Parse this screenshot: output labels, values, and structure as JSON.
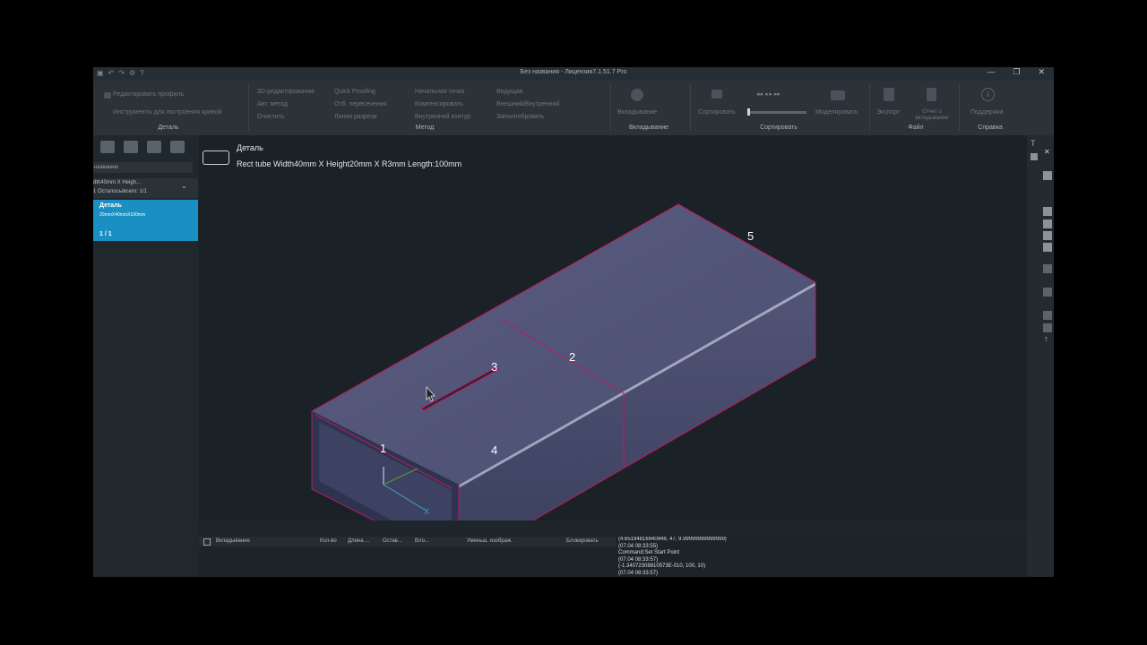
{
  "window": {
    "title": "Без названия - Лицензия7.1.51.7  Pro",
    "min_icon": "—",
    "max_icon": "❐",
    "close_icon": "✕"
  },
  "ribbon": {
    "detail_group": {
      "label": "Деталь",
      "items": [
        "Редактировать профиль",
        "Инструменты для построения кривой"
      ]
    },
    "method_group": {
      "label": "Метод",
      "col1": [
        "3D-редактирование",
        "Авт. метод",
        "Очистить"
      ],
      "col2": [
        "Quick Proofing",
        "Отб. пересечения",
        "Линия разреза"
      ],
      "col3": [
        "Начальная точка",
        "Компенсировать",
        "Внутренний контур"
      ],
      "col4": [
        "Ведущая",
        "Внешний/Внутренний",
        "Заполнобровать"
      ]
    },
    "nesting_group": {
      "label": "Вкладывание",
      "button": "Вкладывание"
    },
    "sort_group": {
      "label": "Сортировать",
      "button": "Сортировать"
    },
    "sim_button": "Моделировать",
    "file_group": {
      "label": "Файл",
      "export": "Экспорт",
      "report": "Отчет о вкладывании"
    },
    "help_group": {
      "label": "Справка",
      "support": "Поддержка"
    }
  },
  "left_panel": {
    "search": "названию",
    "item_name": "dth40mm X Heigh...",
    "item_count": "1   Осталось/всего: 1/1",
    "card_title": "Деталь",
    "card_sub": "20mmX40mmX100mm",
    "card_count": "1 / 1"
  },
  "viewport": {
    "part_title": "Деталь",
    "part_desc": "Rect tube Width40mm X Height20mm X R3mm Length:100mm",
    "markers": [
      "1",
      "2",
      "3",
      "4",
      "5"
    ],
    "axis_x": "X"
  },
  "bottom_table": {
    "columns": [
      "Вкладывание",
      "Кол-во",
      "Длина ...",
      "Остав...",
      "Вло...",
      "Уменьш. изображ.",
      "Блокировать"
    ]
  },
  "log": {
    "lines": [
      "(4.65194816940948, 47, 9.99999999999999)",
      "(07.04 08:33:55)",
      "Command:Set Start Point",
      "(07.04 08:33:57)",
      "(-1.34072308810573E-010, 100, 10)",
      "(07.04 08:33:57)"
    ]
  },
  "colors": {
    "accent": "#1a8fc2",
    "edge": "#c2185b",
    "tube": "#4a4e70"
  }
}
